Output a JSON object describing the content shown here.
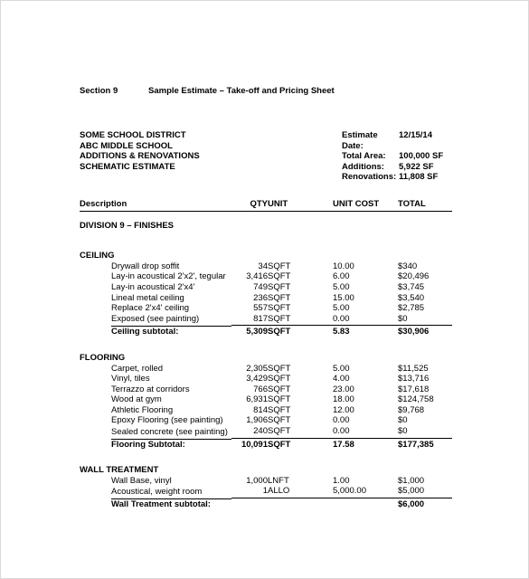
{
  "document": {
    "section_label": "Section 9",
    "title": "Sample Estimate – Take-off and Pricing Sheet"
  },
  "project": {
    "lines": [
      "SOME SCHOOL DISTRICT",
      "ABC MIDDLE SCHOOL",
      "ADDITIONS & RENOVATIONS",
      "SCHEMATIC ESTIMATE"
    ]
  },
  "estimate_info": [
    {
      "label": "Estimate Date:",
      "value": "12/15/14"
    },
    {
      "label": "Total Area:",
      "value": "100,000 SF"
    },
    {
      "label": "Additions:",
      "value": "5,922 SF"
    },
    {
      "label": "Renovations:",
      "value": "11,808 SF"
    }
  ],
  "table": {
    "columns": {
      "description": "Description",
      "qty": "QTY",
      "unit": "UNIT",
      "unit_cost": "UNIT COST",
      "total": "TOTAL"
    },
    "division": "DIVISION 9 – FINISHES",
    "groups": [
      {
        "name": "CEILING",
        "items": [
          {
            "description": "Drywall drop soffit",
            "qty": "34",
            "unit": "SQFT",
            "unit_cost": "10.00",
            "total": "$340"
          },
          {
            "description": "Lay-in acoustical 2'x2', tegular",
            "qty": "3,416",
            "unit": "SQFT",
            "unit_cost": "6.00",
            "total": "$20,496"
          },
          {
            "description": "Lay-in acoustical 2'x4'",
            "qty": "749",
            "unit": "SQFT",
            "unit_cost": "5.00",
            "total": "$3,745"
          },
          {
            "description": "Lineal metal ceiling",
            "qty": "236",
            "unit": "SQFT",
            "unit_cost": "15.00",
            "total": "$3,540"
          },
          {
            "description": "Replace 2'x4' ceiling",
            "qty": "557",
            "unit": "SQFT",
            "unit_cost": "5.00",
            "total": "$2,785"
          },
          {
            "description": "Exposed (see painting)",
            "qty": "817",
            "unit": "SQFT",
            "unit_cost": "0.00",
            "total": "$0"
          }
        ],
        "subtotal": {
          "description": "Ceiling subtotal:",
          "qty": "5,309",
          "unit": "SQFT",
          "unit_cost": "5.83",
          "total": "$30,906"
        }
      },
      {
        "name": "FLOORING",
        "items": [
          {
            "description": "Carpet, rolled",
            "qty": "2,305",
            "unit": "SQFT",
            "unit_cost": "5.00",
            "total": "$11,525"
          },
          {
            "description": "Vinyl, tiles",
            "qty": "3,429",
            "unit": "SQFT",
            "unit_cost": "4.00",
            "total": "$13,716"
          },
          {
            "description": "Terrazzo at corridors",
            "qty": "766",
            "unit": "SQFT",
            "unit_cost": "23.00",
            "total": "$17,618"
          },
          {
            "description": "Wood at gym",
            "qty": "6,931",
            "unit": "SQFT",
            "unit_cost": "18.00",
            "total": "$124,758"
          },
          {
            "description": "Athletic Flooring",
            "qty": "814",
            "unit": "SQFT",
            "unit_cost": "12.00",
            "total": "$9,768"
          },
          {
            "description": "Epoxy Flooring (see painting)",
            "qty": "1,906",
            "unit": "SQFT",
            "unit_cost": "0.00",
            "total": "$0"
          },
          {
            "description": "Sealed concrete (see painting)",
            "qty": "240",
            "unit": "SQFT",
            "unit_cost": "0.00",
            "total": "$0"
          }
        ],
        "subtotal": {
          "description": "Flooring Subtotal:",
          "qty": "10,091",
          "unit": "SQFT",
          "unit_cost": "17.58",
          "total": "$177,385"
        }
      },
      {
        "name": "WALL TREATMENT",
        "items": [
          {
            "description": "Wall Base, vinyl",
            "qty": "1,000",
            "unit": "LNFT",
            "unit_cost": "1.00",
            "total": "$1,000"
          },
          {
            "description": "Acoustical, weight room",
            "qty": "1",
            "unit": "ALLO",
            "unit_cost": "5,000.00",
            "total": "$5,000"
          }
        ],
        "subtotal": {
          "description": "Wall Treatment subtotal:",
          "qty": "",
          "unit": "",
          "unit_cost": "",
          "total": "$6,000"
        }
      }
    ]
  }
}
